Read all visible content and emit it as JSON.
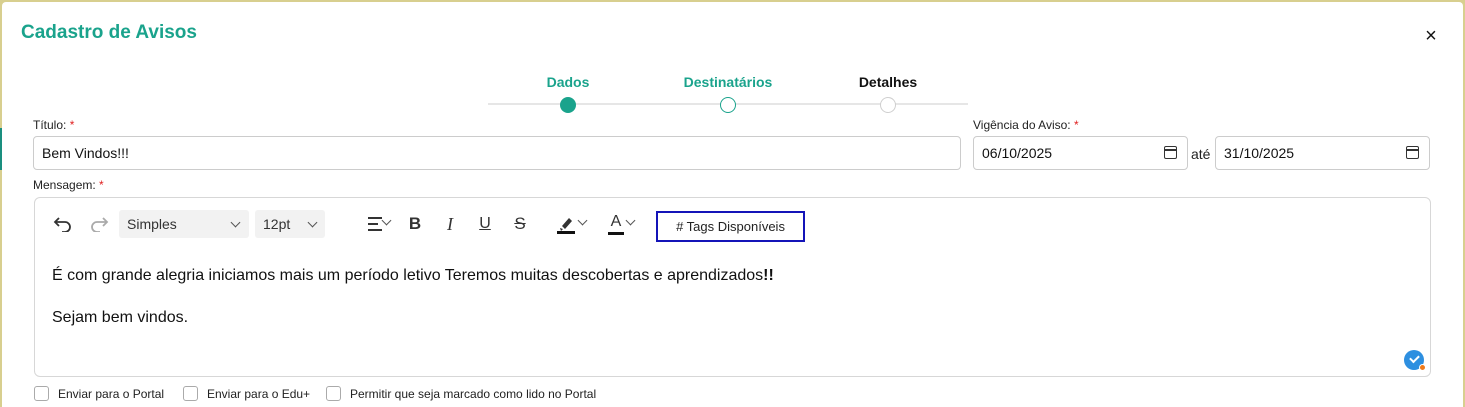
{
  "modal": {
    "title": "Cadastro de Avisos",
    "close": "×"
  },
  "stepper": {
    "steps": [
      {
        "label": "Dados",
        "state": "done"
      },
      {
        "label": "Destinatários",
        "state": "active"
      },
      {
        "label": "Detalhes",
        "state": "pending"
      }
    ]
  },
  "form": {
    "titulo_label": "Título:",
    "titulo_value": "Bem Vindos!!!",
    "vigencia_label": "Vigência do Aviso:",
    "date_from": "06/10/2025",
    "ate": "até",
    "date_to": "31/10/2025",
    "mensagem_label": "Mensagem:",
    "required_mark": "*"
  },
  "toolbar": {
    "block_format": "Simples",
    "font_size": "12pt",
    "bold": "B",
    "italic": "I",
    "underline": "U",
    "strike": "S",
    "font_color": "A",
    "tags_button": "# Tags Disponíveis"
  },
  "editor": {
    "paragraph1": "É com grande alegria iniciamos mais um período letivo Teremos muitas descobertas e aprendizados",
    "paragraph1_bold": "!!",
    "paragraph2": "Sejam bem vindos."
  },
  "options": [
    {
      "label": "Enviar para o Portal"
    },
    {
      "label": "Enviar para o Edu+"
    },
    {
      "label": "Permitir que seja marcado como lido no Portal"
    }
  ],
  "colors": {
    "accent": "#1aa38c",
    "tags_border": "#1414b8",
    "required": "#e02020"
  }
}
